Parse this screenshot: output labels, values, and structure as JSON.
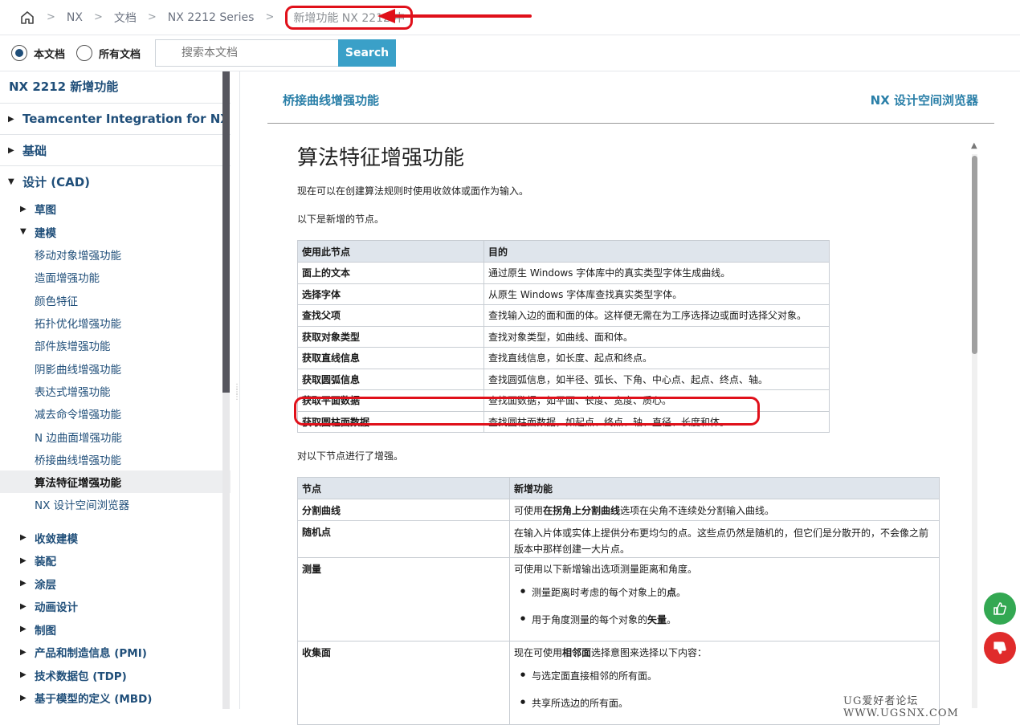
{
  "breadcrumb": {
    "items": [
      "NX",
      "文档",
      "NX 2212 Series"
    ],
    "current": "新增功能 NX 2212 中"
  },
  "search": {
    "scope_this": "本文档",
    "scope_all": "所有文档",
    "placeholder": "搜索本文档",
    "button": "Search"
  },
  "sidebar": {
    "title": "NX 2212 新增功能",
    "l1": [
      "Teamcenter Integration for NX",
      "基础",
      "设计 (CAD)"
    ],
    "design_children": {
      "sketch": "草图",
      "modeling": "建模",
      "modeling_items": [
        "移动对象增强功能",
        "造面增强功能",
        "颜色特征",
        "拓扑优化增强功能",
        "部件族增强功能",
        "阴影曲线增强功能",
        "表达式增强功能",
        "减去命令增强功能",
        "N 边曲面增强功能",
        "桥接曲线增强功能",
        "算法特征增强功能",
        "NX 设计空间浏览器"
      ],
      "rest": [
        "收敛建模",
        "装配",
        "涂层",
        "动画设计",
        "制图",
        "产品和制造信息 (PMI)",
        "技术数据包 (TDP)",
        "基于模型的定义 (MBD)"
      ]
    }
  },
  "nav": {
    "prev": "桥接曲线增强功能",
    "next": "NX 设计空间浏览器"
  },
  "article": {
    "title": "算法特征增强功能",
    "intro": "现在可以在创建算法规则时使用收敛体或面作为输入。",
    "new_nodes_intro": "以下是新增的节点。",
    "table1": {
      "headers": [
        "使用此节点",
        "目的"
      ],
      "rows": [
        [
          "面上的文本",
          "通过原生 Windows 字体库中的真实类型字体生成曲线。"
        ],
        [
          "选择字体",
          "从原生 Windows 字体库查找真实类型字体。"
        ],
        [
          "查找父项",
          "查找输入边的面和面的体。这样便无需在为工序选择边或面时选择父对象。"
        ],
        [
          "获取对象类型",
          "查找对象类型，如曲线、面和体。"
        ],
        [
          "获取直线信息",
          "查找直线信息，如长度、起点和终点。"
        ],
        [
          "获取圆弧信息",
          "查找圆弧信息，如半径、弧长、下角、中心点、起点、终点、轴。"
        ],
        [
          "获取平面数据",
          "查找面数据，如平面、长度、宽度、质心。"
        ],
        [
          "获取圆柱面数据",
          "查找圆柱面数据，如起点、终点、轴、直径、长度和体。"
        ]
      ]
    },
    "enhanced_intro": "对以下节点进行了增强。",
    "table2": {
      "headers": [
        "节点",
        "新增功能"
      ],
      "r1": {
        "name": "分割曲线",
        "pre": "可使用",
        "bold": "在拐角上分割曲线",
        "post": "选项在尖角不连续处分割输入曲线。"
      },
      "r2": {
        "name": "随机点",
        "text": "在输入片体或实体上提供分布更均匀的点。这些点仍然是随机的，但它们是分散开的，不会像之前版本中那样创建一大片点。"
      },
      "r3": {
        "name": "测量",
        "text": "可使用以下新增输出选项测量距离和角度。",
        "li1_pre": "测量距离时考虑的每个对象上的",
        "li1_bold": "点",
        "li1_post": "。",
        "li2_pre": "用于角度测量的每个对象的",
        "li2_bold": "矢量",
        "li2_post": "。"
      },
      "r4": {
        "name": "收集面",
        "pre": "现在可使用",
        "bold": "相邻面",
        "post": "选择意图来选择以下内容：",
        "li1": "与选定面直接相邻的所有面。",
        "li2": "共享所选边的所有面。"
      }
    }
  },
  "watermark": "UG爱好者论坛 WWW.UGSNX.COM"
}
